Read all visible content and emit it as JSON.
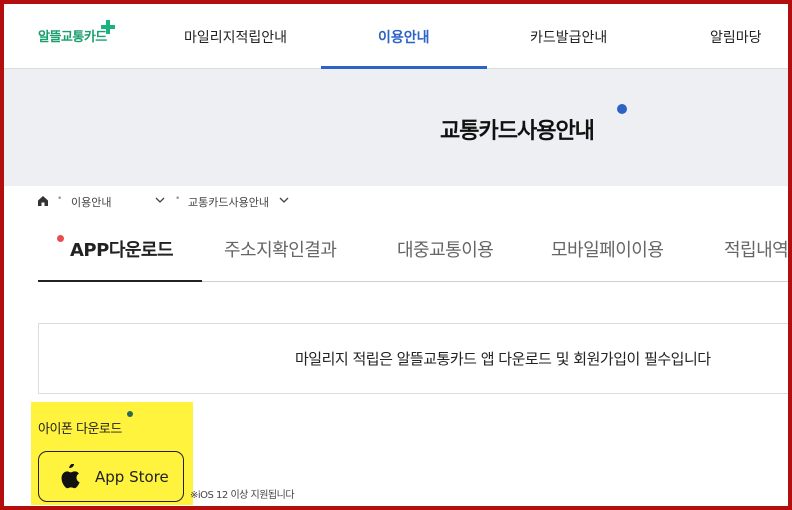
{
  "header": {
    "logo_text": "알뜰교통카드",
    "nav": [
      {
        "label": "마일리지적립안내"
      },
      {
        "label": "이용안내"
      },
      {
        "label": "카드발급안내"
      },
      {
        "label": "알림마당"
      }
    ],
    "active_nav_color": "#2d62c6"
  },
  "banner": {
    "title": "교통카드사용안내"
  },
  "breadcrumb": {
    "home_icon": "home-icon",
    "level1": "이용안내",
    "level2": "교통카드사용안내"
  },
  "tabs": [
    {
      "label": "APP다운로드"
    },
    {
      "label": "주소지확인결과"
    },
    {
      "label": "대중교통이용"
    },
    {
      "label": "모바일페이이용"
    },
    {
      "label": "적립내역"
    }
  ],
  "notice": {
    "text": "마일리지 적립은 알뜰교통카드 앱 다운로드 및 회원가입이 필수입니다"
  },
  "download": {
    "section_label": "아이폰 다운로드",
    "button_icon": "apple-icon",
    "button_label": "App Store",
    "note": "※iOS 12 이상 지원됩니다"
  },
  "colors": {
    "frame": "#b30f0f",
    "brand_green": "#1a9e6e",
    "highlight": "#fff33d",
    "tab_dot": "#e84c4c"
  }
}
